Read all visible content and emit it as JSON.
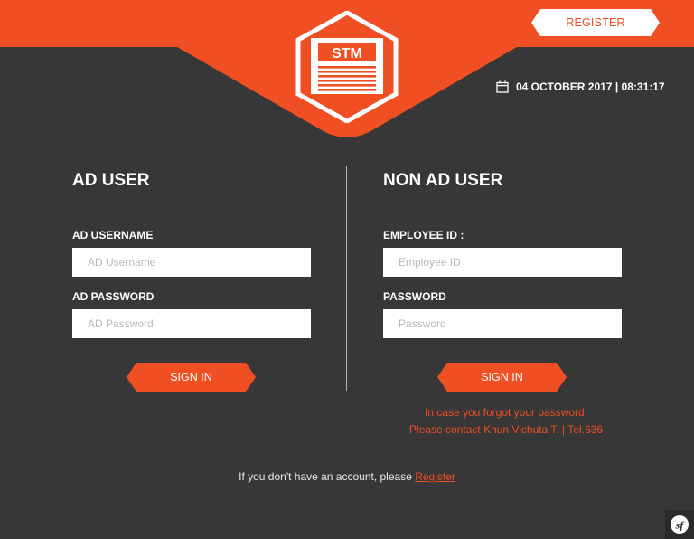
{
  "header": {
    "register_label": "REGISTER",
    "logo_text": "STM",
    "datetime": "04 OCTOBER 2017 | 08:31:17",
    "calendar_icon": "calendar-icon"
  },
  "ad_user": {
    "title": "AD USER",
    "username_label": "AD USERNAME",
    "username_placeholder": "AD Username",
    "password_label": "AD PASSWORD",
    "password_placeholder": "AD Password",
    "sign_in_label": "SIGN IN"
  },
  "non_ad_user": {
    "title": "NON AD USER",
    "employee_label": "EMPLOYEE ID :",
    "employee_placeholder": "Employee ID",
    "password_label": "PASSWORD",
    "password_placeholder": "Password",
    "sign_in_label": "SIGN IN",
    "forgot_line1": "In case you forgot your password,",
    "forgot_line2": "Please contact Khun Vichuta T. | Tel.636"
  },
  "footer": {
    "note_text": "If you don't have an account, please ",
    "register_link": "Register"
  },
  "colors": {
    "accent": "#f04e23",
    "background": "#373737",
    "white": "#ffffff"
  }
}
